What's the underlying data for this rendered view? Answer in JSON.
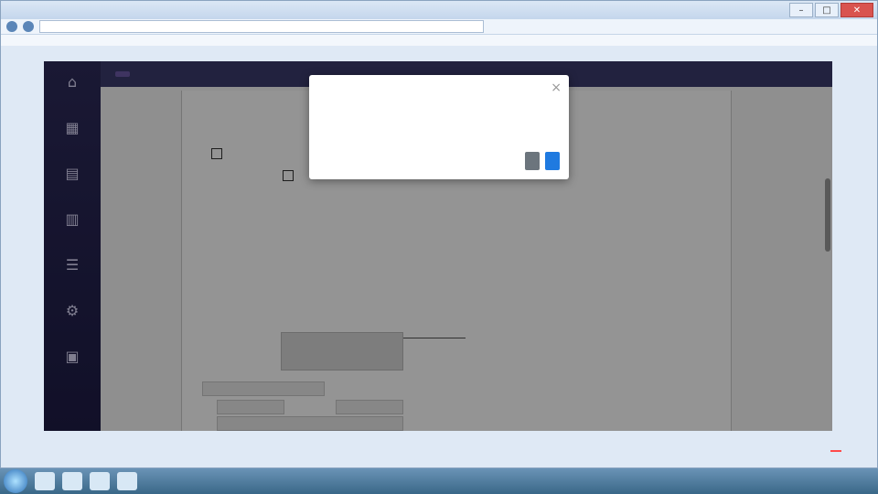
{
  "browser": {
    "window_title": "",
    "address": "",
    "bookmarks": [
      "",
      "",
      "",
      "",
      "",
      ""
    ]
  },
  "sidebar": {
    "items": [
      {
        "icon": "home-icon",
        "label": ""
      },
      {
        "icon": "grid-icon",
        "label": ""
      },
      {
        "icon": "document-icon",
        "label": ""
      },
      {
        "icon": "chart-icon",
        "label": ""
      },
      {
        "icon": "list-icon",
        "label": ""
      },
      {
        "icon": "settings-icon",
        "label": ""
      },
      {
        "icon": "box-icon",
        "label": ""
      }
    ]
  },
  "topbar": {
    "breadcrumb": "",
    "active_tab": ""
  },
  "document": {
    "header_line": "",
    "section_label": "",
    "option_line": "",
    "paragraph_1": "",
    "paragraph_2": "",
    "signature_label": "",
    "signature": "",
    "stamp_label": "",
    "stamp_box": "",
    "row1_label": "",
    "row1_value": "",
    "row2_label": "",
    "row2_value": "",
    "row2b_label": "",
    "row2b_value": "",
    "row3_label": "",
    "row3_value": ""
  },
  "dialog": {
    "message": "",
    "cancel_label": "",
    "ok_label": ""
  },
  "taskbar": {
    "clock": "",
    "status_badge": ""
  },
  "colors": {
    "sidebar": "#2d2b5a",
    "topbar": "#3c3b6d",
    "active_tab": "#6d5aa8",
    "ok_button": "#1f7ae0",
    "cancel_button": "#6c757d"
  }
}
